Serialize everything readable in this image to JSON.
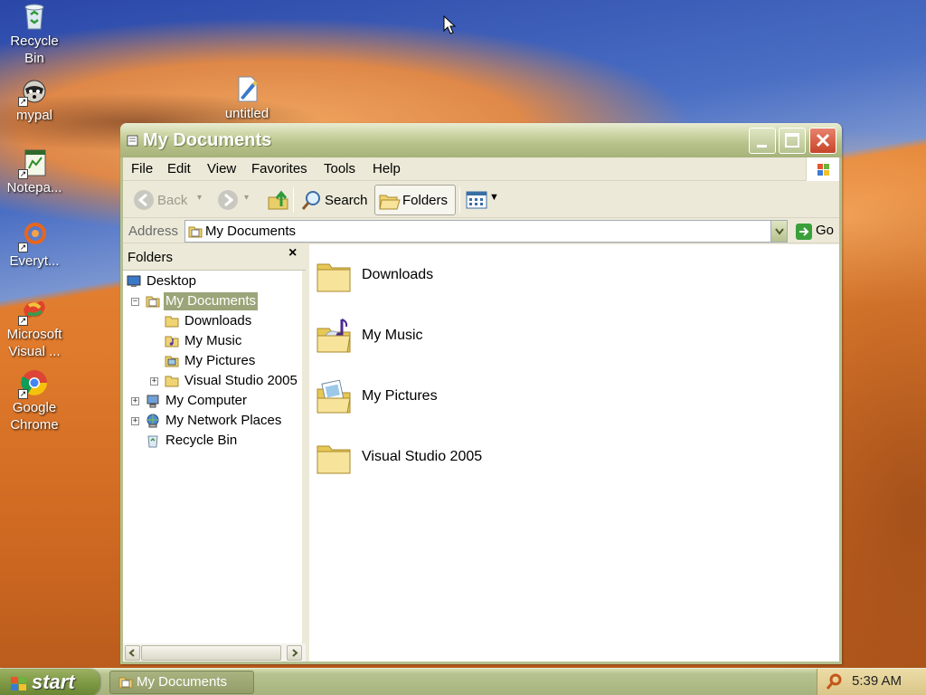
{
  "desktop": {
    "icons": [
      {
        "label": "Recycle Bin",
        "icon": "recycle-bin-icon"
      },
      {
        "label": "mypal",
        "icon": "raccoon-icon"
      },
      {
        "label": "untitled",
        "icon": "paint-document-icon"
      },
      {
        "label": "Notepa...",
        "icon": "notepad-icon"
      },
      {
        "label": "Everyt...",
        "icon": "everything-search-icon"
      },
      {
        "label": "Microsoft Visual ...",
        "icon": "visual-studio-icon"
      },
      {
        "label": "Google Chrome",
        "icon": "chrome-icon"
      }
    ]
  },
  "window": {
    "title": "My Documents",
    "menu": [
      "File",
      "Edit",
      "View",
      "Favorites",
      "Tools",
      "Help"
    ],
    "toolbar": {
      "back_label": "Back",
      "search_label": "Search",
      "folders_label": "Folders"
    },
    "address": {
      "label": "Address",
      "value": "My Documents",
      "go_label": "Go"
    },
    "folders_pane": {
      "title": "Folders",
      "close": "×",
      "tree": [
        {
          "label": "Desktop",
          "level": 0,
          "expander": ""
        },
        {
          "label": "My Documents",
          "level": 1,
          "expander": "−",
          "selected": true
        },
        {
          "label": "Downloads",
          "level": 2,
          "expander": ""
        },
        {
          "label": "My Music",
          "level": 2,
          "expander": ""
        },
        {
          "label": "My Pictures",
          "level": 2,
          "expander": ""
        },
        {
          "label": "Visual Studio 2005",
          "level": 2,
          "expander": "+"
        },
        {
          "label": "My Computer",
          "level": 1,
          "expander": "+"
        },
        {
          "label": "My Network Places",
          "level": 1,
          "expander": "+"
        },
        {
          "label": "Recycle Bin",
          "level": 1,
          "expander": ""
        }
      ]
    },
    "content_items": [
      {
        "label": "Downloads",
        "icon": "folder-icon"
      },
      {
        "label": "My Music",
        "icon": "music-folder-icon"
      },
      {
        "label": "My Pictures",
        "icon": "pictures-folder-icon"
      },
      {
        "label": "Visual Studio 2005",
        "icon": "folder-icon"
      }
    ]
  },
  "taskbar": {
    "start_label": "start",
    "tasks": [
      {
        "label": "My Documents"
      }
    ],
    "clock": "5:39 AM"
  }
}
